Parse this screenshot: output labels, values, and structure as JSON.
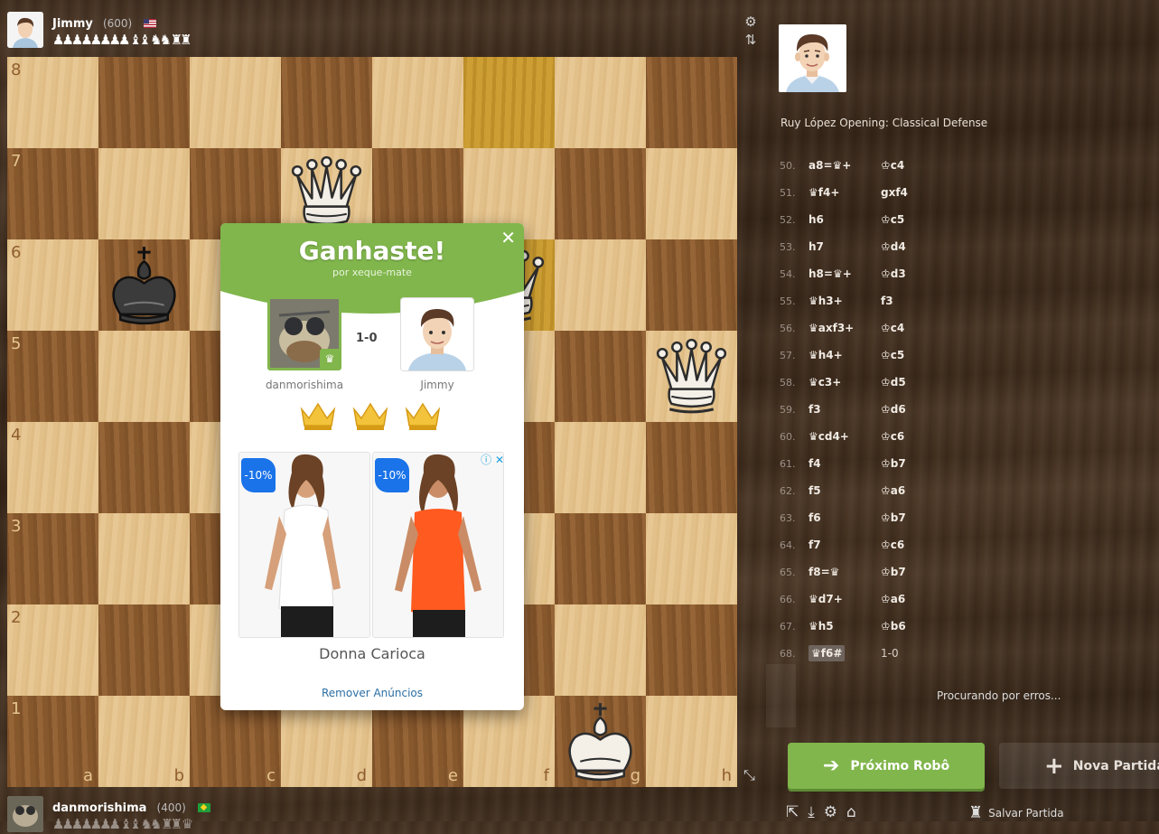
{
  "top_player": {
    "name": "Jimmy",
    "rating": "(600)",
    "flag": "us-flag",
    "captured": "♟♟♟♟♟♟♟♟ ♝♝ ♞♞ ♜♜"
  },
  "bottom_player": {
    "name": "danmorishima",
    "rating": "(400)",
    "flag": "br-flag",
    "captured": "♟♟♟♟♟♟♟ ♝♝ ♞♞ ♜♜ ♛"
  },
  "board": {
    "ranks": [
      "8",
      "7",
      "6",
      "5",
      "4",
      "3",
      "2",
      "1"
    ],
    "files": [
      "a",
      "b",
      "c",
      "d",
      "e",
      "f",
      "g",
      "h"
    ],
    "pieces": [
      {
        "square": "d7",
        "piece": "white-queen",
        "glyph": "♛"
      },
      {
        "square": "f6",
        "piece": "white-queen",
        "glyph": "♛"
      },
      {
        "square": "h5",
        "piece": "white-queen",
        "glyph": "♛"
      },
      {
        "square": "b6",
        "piece": "black-king",
        "glyph": "♚"
      },
      {
        "square": "g1",
        "piece": "white-king",
        "glyph": "♚"
      }
    ],
    "highlighted": [
      "f8",
      "f6"
    ]
  },
  "panel": {
    "opening": "Ruy López Opening: Classical Defense",
    "moves": [
      {
        "n": "50.",
        "w": "a8=♛+",
        "b": "♔c4"
      },
      {
        "n": "51.",
        "w": "♛f4+",
        "b": "gxf4"
      },
      {
        "n": "52.",
        "w": "h6",
        "b": "♔c5"
      },
      {
        "n": "53.",
        "w": "h7",
        "b": "♔d4"
      },
      {
        "n": "54.",
        "w": "h8=♛+",
        "b": "♔d3"
      },
      {
        "n": "55.",
        "w": "♛h3+",
        "b": "f3"
      },
      {
        "n": "56.",
        "w": "♛axf3+",
        "b": "♔c4"
      },
      {
        "n": "57.",
        "w": "♛h4+",
        "b": "♔c5"
      },
      {
        "n": "58.",
        "w": "♛c3+",
        "b": "♔d5"
      },
      {
        "n": "59.",
        "w": "f3",
        "b": "♔d6"
      },
      {
        "n": "60.",
        "w": "♛cd4+",
        "b": "♔c6"
      },
      {
        "n": "61.",
        "w": "f4",
        "b": "♔b7"
      },
      {
        "n": "62.",
        "w": "f5",
        "b": "♔a6"
      },
      {
        "n": "63.",
        "w": "f6",
        "b": "♔b7"
      },
      {
        "n": "64.",
        "w": "f7",
        "b": "♔c6"
      },
      {
        "n": "65.",
        "w": "f8=♛",
        "b": "♔b7"
      },
      {
        "n": "66.",
        "w": "♛d7+",
        "b": "♔a6"
      },
      {
        "n": "67.",
        "w": "♛h5",
        "b": "♔b6"
      },
      {
        "n": "68.",
        "w": "♛f6#",
        "b": "1-0"
      }
    ],
    "searching": "Procurando por erros...",
    "next_bot": "Próximo Robô",
    "new_game": "Nova Partida",
    "save_game": "Salvar Partida"
  },
  "modal": {
    "title": "Ganhaste!",
    "subtitle": "por xeque-mate",
    "score": "1-0",
    "winner": "danmorishima",
    "loser": "Jimmy",
    "ad_discount_1": "-10%",
    "ad_discount_2": "-10%",
    "ad_brand": "Donna Carioca",
    "remove_ads": "Remover Anúncios"
  },
  "colors": {
    "accent_green": "#81b64c",
    "board_light": "#e6c58f",
    "board_dark": "#8f5e31",
    "highlight": "#c99a2e"
  }
}
